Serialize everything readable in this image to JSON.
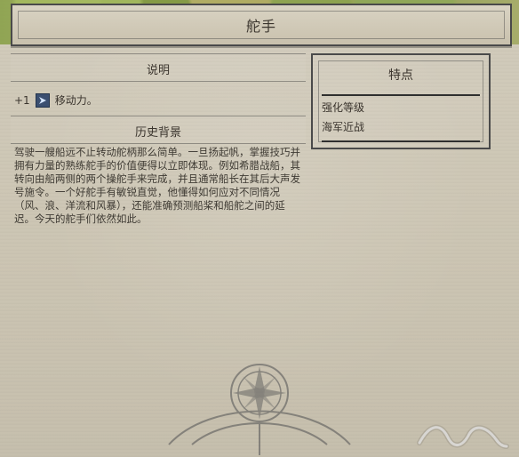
{
  "title": "舵手",
  "left": {
    "description_header": "说明",
    "effect_prefix": "+1",
    "effect_text": "移动力。",
    "history_header": "历史背景",
    "history_body": "驾驶一艘船远不止转动舵柄那么简单。一旦扬起帆，掌握技巧并拥有力量的熟练舵手的价值便得以立即体现。例如希腊战船，其转向由船两侧的两个操舵手来完成，并且通常船长在其后大声发号施令。一个好舵手有敏锐直觉，他懂得如何应对不同情况（风、浪、洋流和风暴），还能准确预测船桨和船舵之间的延迟。今天的舵手们依然如此。"
  },
  "right": {
    "header": "特点",
    "items": [
      {
        "label": "强化等级"
      },
      {
        "label": "海军近战"
      }
    ]
  },
  "icons": {
    "movement": "movement-icon",
    "compass": "compass-icon",
    "mountains": "mountains-icon"
  },
  "colors": {
    "text": "#3b352e",
    "border": "#4a4a4a",
    "background": "#cfc9b8",
    "movement_icon": "#3b4f70"
  }
}
